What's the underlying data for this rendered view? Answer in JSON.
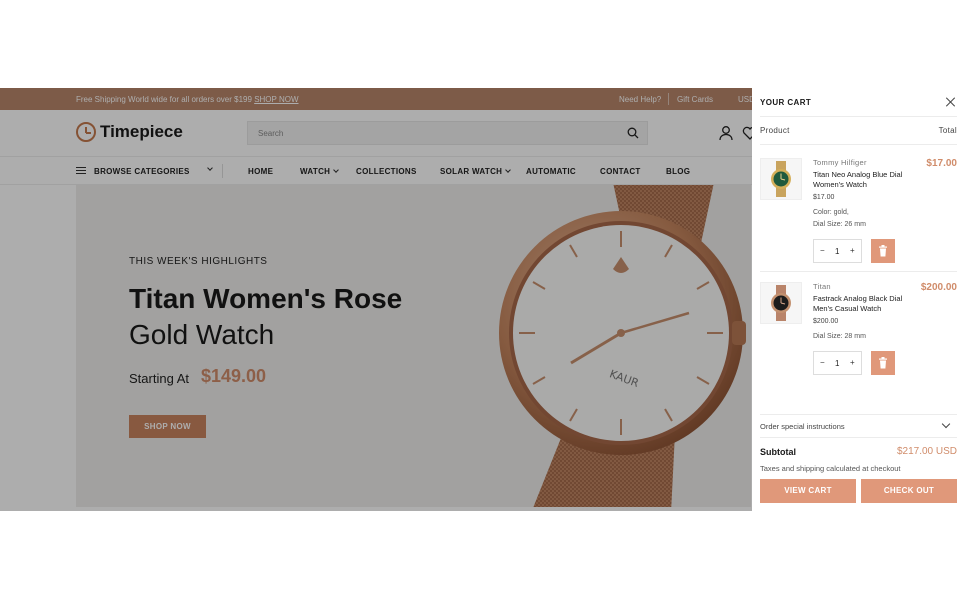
{
  "topbar": {
    "shipping_text": "Free Shipping World wide for all orders over $199",
    "shop_link": "SHOP NOW",
    "help": "Need Help?",
    "gift_cards": "Gift Cards",
    "currency": "USD"
  },
  "header": {
    "logo": "Timepiece",
    "search_placeholder": "Search"
  },
  "nav": {
    "browse": "BROWSE CATEGORIES",
    "items": [
      "HOME",
      "WATCH",
      "COLLECTIONS",
      "SOLAR WATCH",
      "AUTOMATIC",
      "CONTACT",
      "BLOG"
    ]
  },
  "hero": {
    "eyebrow": "THIS WEEK'S HIGHLIGHTS",
    "title_line1": "Titan Women's Rose",
    "title_line2": "Gold Watch",
    "starting_at": "Starting At",
    "price": "$149.00",
    "button": "SHOP NOW",
    "watch_text": "KAUR"
  },
  "cart": {
    "title": "YOUR CART",
    "col_product": "Product",
    "col_total": "Total",
    "items": [
      {
        "vendor": "Tommy Hilfiger",
        "name": "Titan Neo Analog Blue Dial Women's Watch",
        "unit_price": "$17.00",
        "option1": "Color: gold,",
        "option2": "Dial Size: 26 mm",
        "quantity": "1",
        "line_price": "$17.00"
      },
      {
        "vendor": "Titan",
        "name": "Fastrack Analog Black Dial Men's Casual Watch",
        "unit_price": "$200.00",
        "option1": "Dial Size: 28 mm",
        "quantity": "1",
        "line_price": "$200.00"
      }
    ],
    "instructions": "Order special instructions",
    "subtotal_label": "Subtotal",
    "subtotal_value": "$217.00 USD",
    "tax_note": "Taxes and shipping calculated at checkout",
    "view_cart": "VIEW CART",
    "checkout": "CHECK OUT"
  },
  "colors": {
    "topbar": "#b9876b",
    "accent": "#d08c6a",
    "button": "#e0987a"
  }
}
